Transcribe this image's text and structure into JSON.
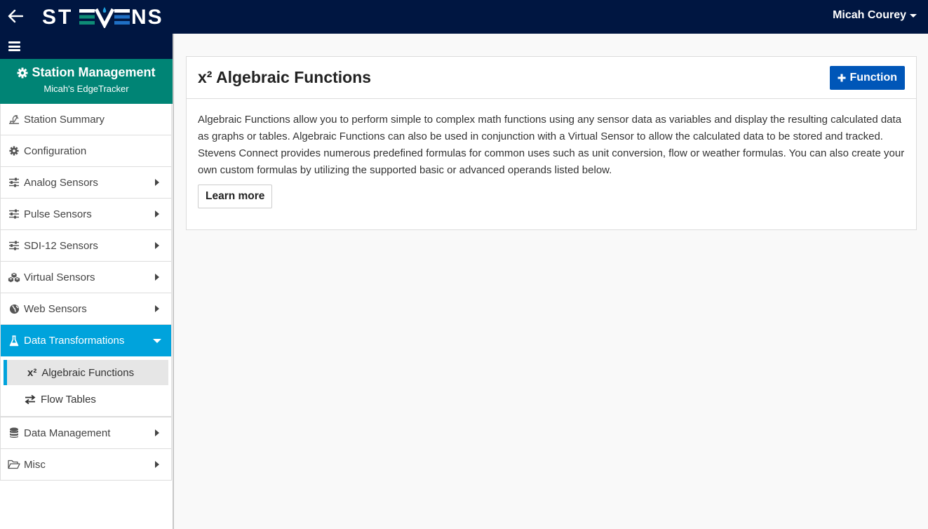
{
  "topbar": {
    "brand": "STEVENS",
    "user_name": "Micah Courey",
    "back_icon": "arrow-left-icon",
    "user_caret_icon": "caret-down-icon"
  },
  "sidebar": {
    "toggle_icon": "hamburger-icon",
    "station": {
      "title": "Station Management",
      "subtitle": "Micah's EdgeTracker",
      "icon": "gear-icon"
    },
    "items": [
      {
        "label": "Station Summary",
        "icon": "satellite-dish-icon",
        "has_arrow": false
      },
      {
        "label": "Configuration",
        "icon": "gear-icon",
        "has_arrow": false
      },
      {
        "label": "Analog Sensors",
        "icon": "sliders-icon",
        "has_arrow": true
      },
      {
        "label": "Pulse Sensors",
        "icon": "sliders-icon",
        "has_arrow": true
      },
      {
        "label": "SDI-12 Sensors",
        "icon": "sliders-icon",
        "has_arrow": true
      },
      {
        "label": "Virtual Sensors",
        "icon": "cubes-icon",
        "has_arrow": true
      },
      {
        "label": "Web Sensors",
        "icon": "globe-icon",
        "has_arrow": true
      },
      {
        "label": "Data Transformations",
        "icon": "flask-icon",
        "has_arrow": true,
        "expanded": true
      },
      {
        "label": "Data Management",
        "icon": "database-icon",
        "has_arrow": true
      },
      {
        "label": "Misc",
        "icon": "folder-open-icon",
        "has_arrow": true
      }
    ],
    "subitems": [
      {
        "label": "Algebraic Functions",
        "icon_text": "x²",
        "selected": true
      },
      {
        "label": "Flow Tables",
        "icon_text": "⇄",
        "selected": false
      }
    ]
  },
  "main": {
    "card": {
      "title": "x² Algebraic Functions",
      "add_button": "Function",
      "add_icon": "plus-icon",
      "description": "Algebraic Functions allow you to perform simple to complex math functions using any sensor data as variables and display the resulting calculated data as graphs or tables. Algebraic Functions can also be used in conjunction with a Virtual Sensor to allow the calculated data to be stored and tracked. Stevens Connect provides numerous predefined formulas for common uses such as unit conversion, flow or weather formulas. You can also create your own custom formulas by utilizing the supported basic or advanced operands listed below.",
      "learn_more": "Learn more"
    }
  },
  "colors": {
    "topbar": "#001641",
    "station_header": "#008475",
    "active_nav": "#00a3dc",
    "primary_button": "#0056b8"
  }
}
